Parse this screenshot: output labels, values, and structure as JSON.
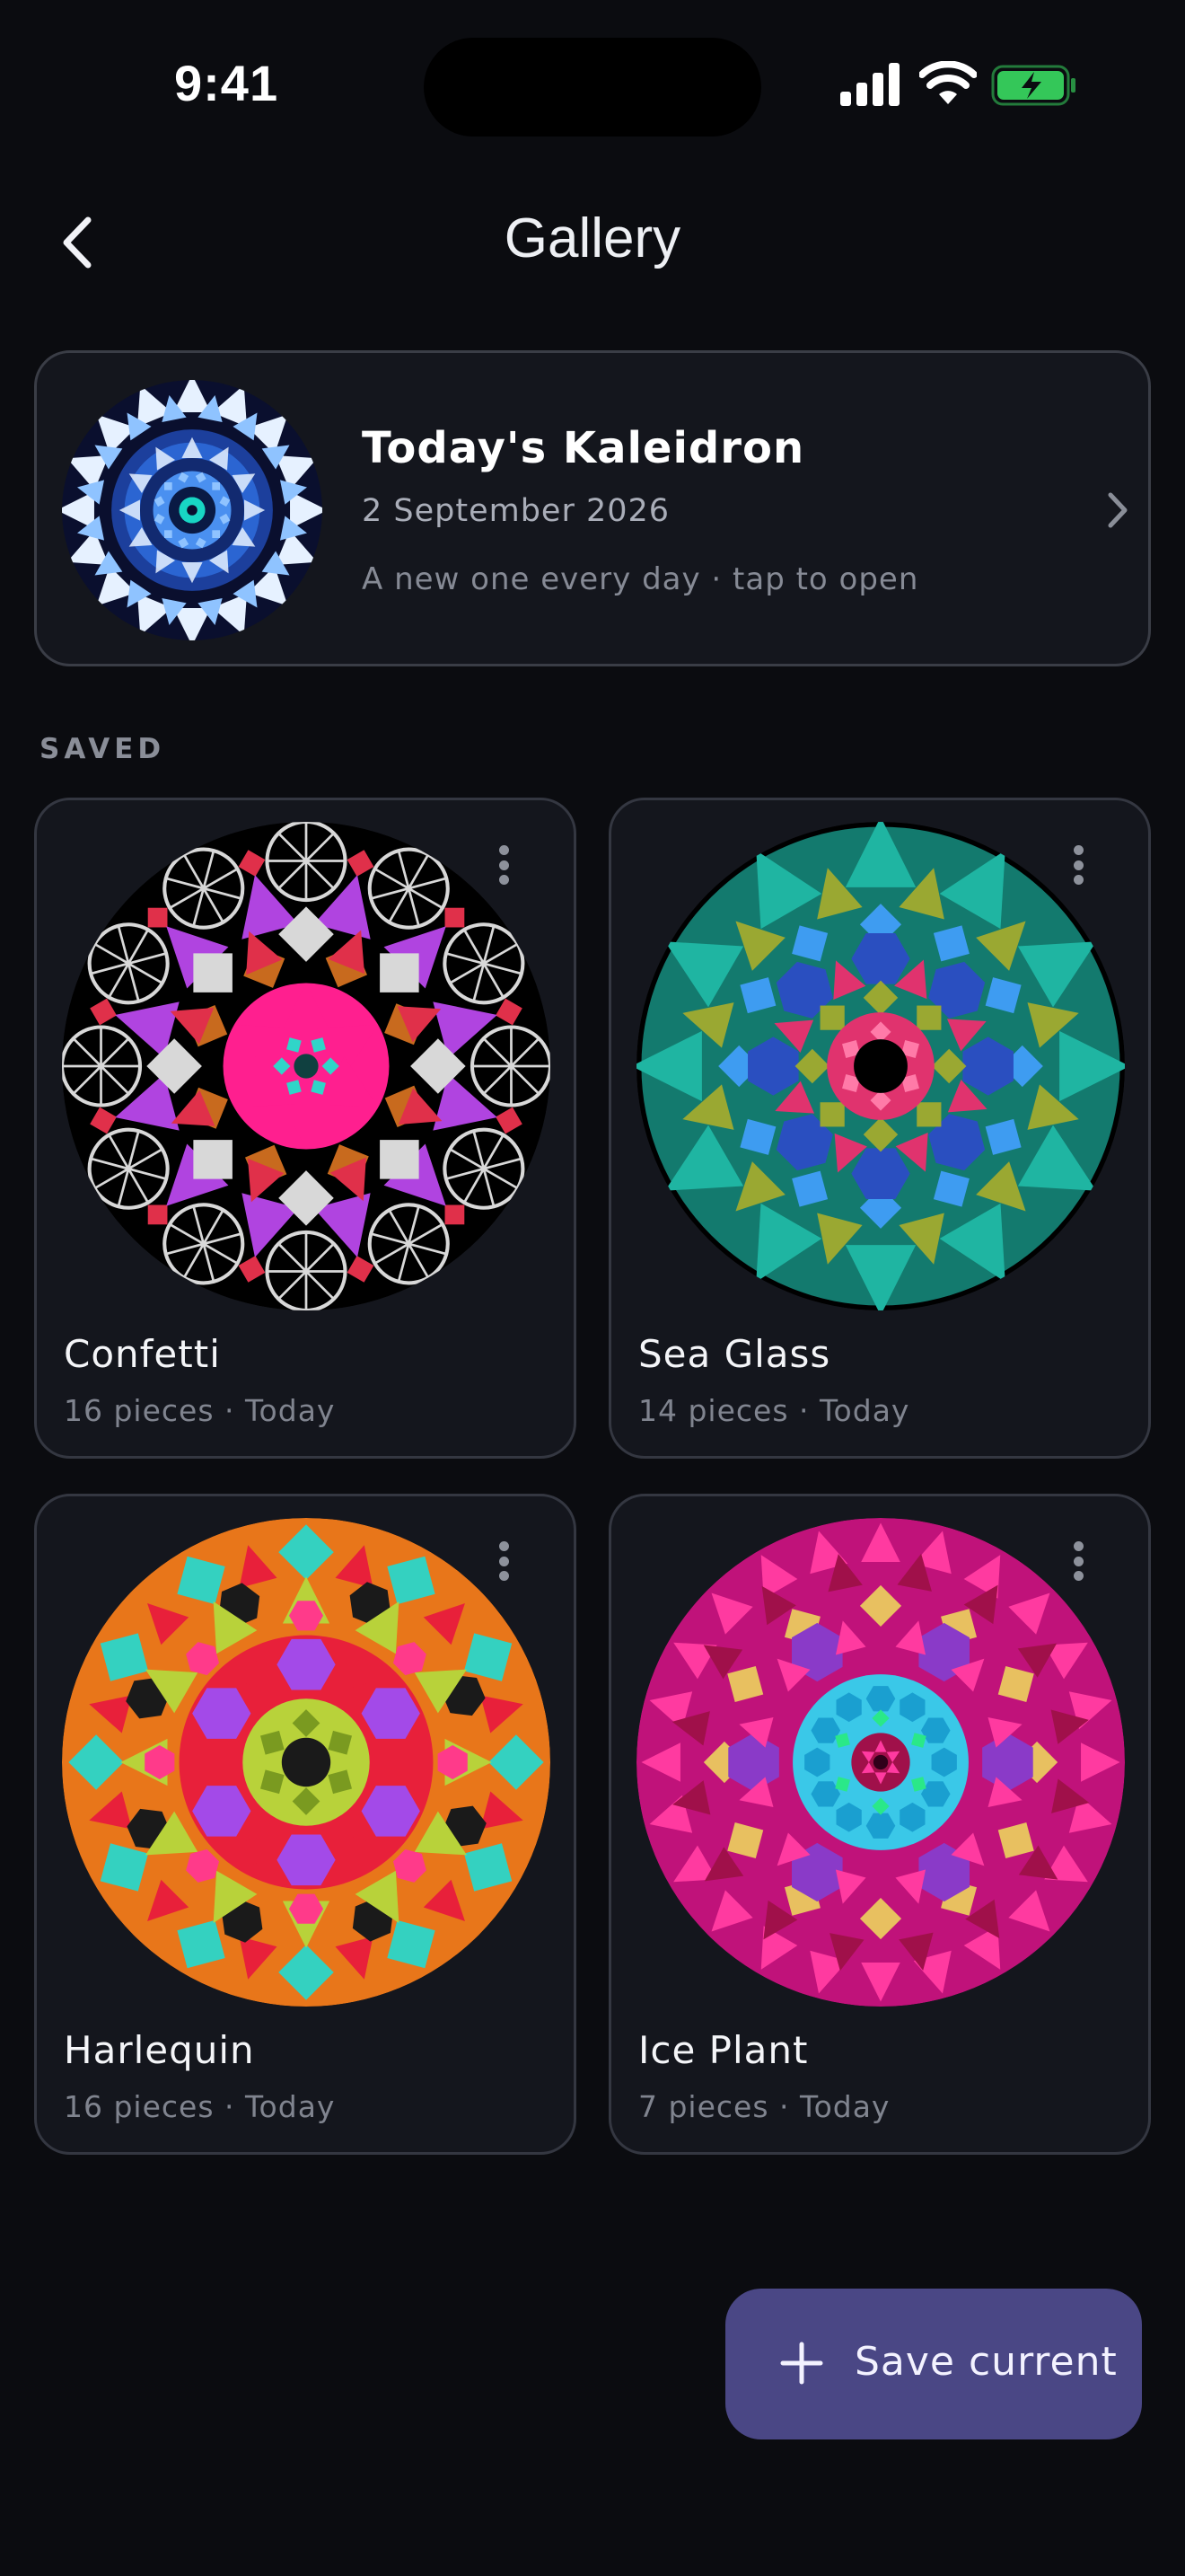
{
  "status_bar": {
    "time": "9:41",
    "icons": [
      "signal-icon",
      "wifi-icon",
      "battery-charging-icon"
    ],
    "battery_color": "#34c759"
  },
  "header": {
    "back_icon": "chevron-left-icon",
    "title": "Gallery"
  },
  "featured": {
    "title": "Today's Kaleidron",
    "date": "2 September 2026",
    "subtitle": "A new one every day · tap to open",
    "chevron_icon": "chevron-right-icon",
    "palette": [
      "#0a0f2e",
      "#2f6fe0",
      "#8fc3ff",
      "#e6f1ff",
      "#18d6c4"
    ]
  },
  "saved": {
    "section_label": "SAVED",
    "items": [
      {
        "name": "Confetti",
        "meta": "16 pieces · Today",
        "menu_icon": "more-vertical-icon",
        "palette": [
          "#000000",
          "#ff1f8f",
          "#b044e0",
          "#d8d8d8",
          "#c86a1e",
          "#e0304a",
          "#30d5c8"
        ]
      },
      {
        "name": "Sea Glass",
        "meta": "14 pieces · Today",
        "menu_icon": "more-vertical-icon",
        "palette": [
          "#000000",
          "#1fb5a2",
          "#9aa832",
          "#2a4fc0",
          "#e0336e",
          "#44a0ff",
          "#e5d2ff"
        ]
      },
      {
        "name": "Harlequin",
        "meta": "16 pieces · Today",
        "menu_icon": "more-vertical-icon",
        "palette": [
          "#e8761a",
          "#34d1c0",
          "#b8d23a",
          "#e8203a",
          "#a34ae8",
          "#1a1a1a",
          "#ff3a8a"
        ]
      },
      {
        "name": "Ice Plant",
        "meta": "7 pieces · Today",
        "menu_icon": "more-vertical-icon",
        "palette": [
          "#c0127a",
          "#ff3aa0",
          "#e8c060",
          "#8a3ac8",
          "#3ac8e8",
          "#2ae888",
          "#a0104a"
        ]
      }
    ]
  },
  "fab": {
    "icon": "plus-icon",
    "label": "Save current"
  }
}
